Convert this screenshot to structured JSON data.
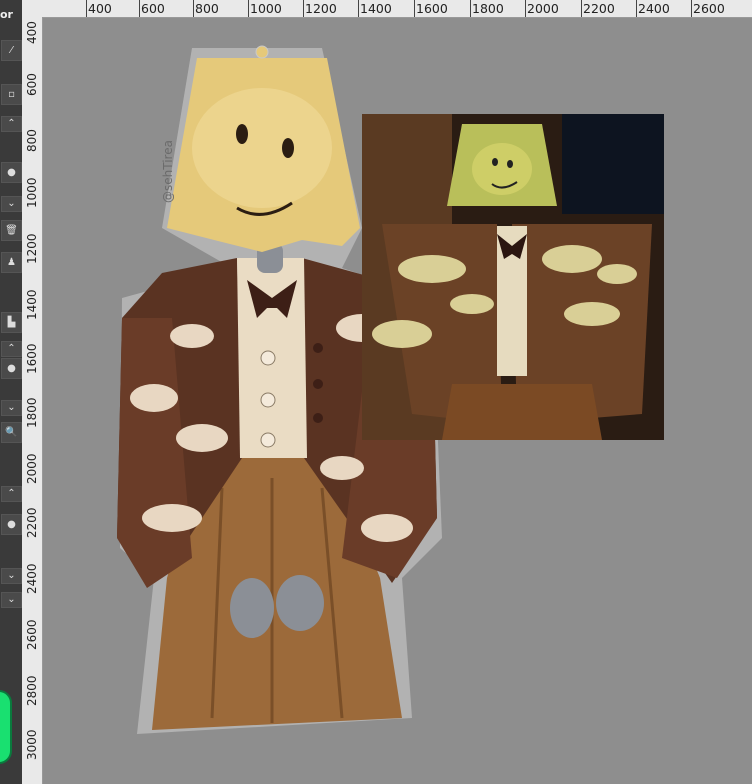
{
  "app": {
    "tool_label": "or"
  },
  "rulers": {
    "horizontal": [
      "400",
      "600",
      "800",
      "1000",
      "1200",
      "1400",
      "1600",
      "1800",
      "2000",
      "2200",
      "2400",
      "2600"
    ],
    "vertical": [
      "400",
      "600",
      "800",
      "1000",
      "1200",
      "1400",
      "1600",
      "1800",
      "2000",
      "2200",
      "2400",
      "2600",
      "2800",
      "3000"
    ]
  },
  "artwork": {
    "watermark": "@sehTirea"
  },
  "colors": {
    "canvas": "#8e8e8e",
    "lampshade": "#e5c97a",
    "cardigan": "#5a3322",
    "skirt": "#9c6a3a",
    "shirt": "#eadcc4",
    "cloud": "#e8d7c2",
    "outline": "#c9c9c9",
    "status_indicator": "#19e070"
  }
}
